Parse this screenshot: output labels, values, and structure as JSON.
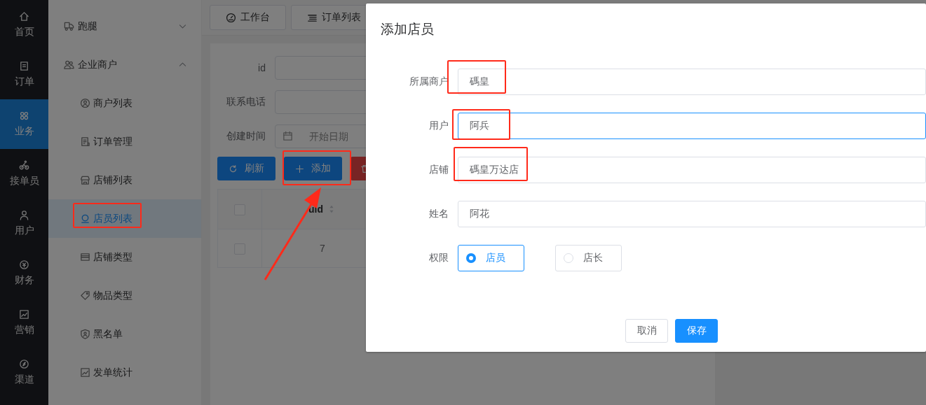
{
  "rail": [
    {
      "label": "首页",
      "selected": false
    },
    {
      "label": "订单",
      "selected": false
    },
    {
      "label": "业务",
      "selected": true
    },
    {
      "label": "接单员",
      "selected": false
    },
    {
      "label": "用户",
      "selected": false
    },
    {
      "label": "财务",
      "selected": false
    },
    {
      "label": "营销",
      "selected": false
    },
    {
      "label": "渠道",
      "selected": false
    }
  ],
  "sidebar": {
    "groups": [
      {
        "label": "跑腿",
        "expanded": false
      },
      {
        "label": "企业商户",
        "expanded": true,
        "children": [
          {
            "label": "商户列表",
            "selected": false
          },
          {
            "label": "订单管理",
            "selected": false
          },
          {
            "label": "店铺列表",
            "selected": false
          },
          {
            "label": "店员列表",
            "selected": true
          },
          {
            "label": "店铺类型",
            "selected": false
          },
          {
            "label": "物品类型",
            "selected": false
          },
          {
            "label": "黑名单",
            "selected": false
          },
          {
            "label": "发单统计",
            "selected": false
          }
        ]
      }
    ]
  },
  "tabs": [
    {
      "label": "工作台"
    },
    {
      "label": "订单列表"
    }
  ],
  "filters": [
    {
      "label": "id",
      "kind": "text"
    },
    {
      "label": "联系电话",
      "kind": "text"
    },
    {
      "label": "创建时间",
      "kind": "date",
      "placeholder": "开始日期"
    }
  ],
  "actions": [
    {
      "label": "刷新",
      "kind": "refresh"
    },
    {
      "label": "添加",
      "kind": "add"
    },
    {
      "kind": "delete"
    }
  ],
  "table": {
    "header_checked": false,
    "columns": [
      "uid"
    ],
    "rows": [
      {
        "checked": false,
        "uid": "7"
      }
    ]
  },
  "dialog": {
    "title": "添加店员",
    "fields": [
      {
        "label": "所属商户",
        "value": "碼皇",
        "focused": false
      },
      {
        "label": "用户",
        "value": "阿兵",
        "focused": true
      },
      {
        "label": "店铺",
        "value": "碼皇万达店",
        "focused": false
      },
      {
        "label": "姓名",
        "value": "阿花",
        "focused": false
      }
    ],
    "permission": {
      "label": "权限",
      "options": [
        {
          "label": "店员",
          "selected": true
        },
        {
          "label": "店长",
          "selected": false
        }
      ]
    },
    "buttons": [
      {
        "label": "取消",
        "kind": "default"
      },
      {
        "label": "保存",
        "kind": "primary"
      }
    ]
  }
}
